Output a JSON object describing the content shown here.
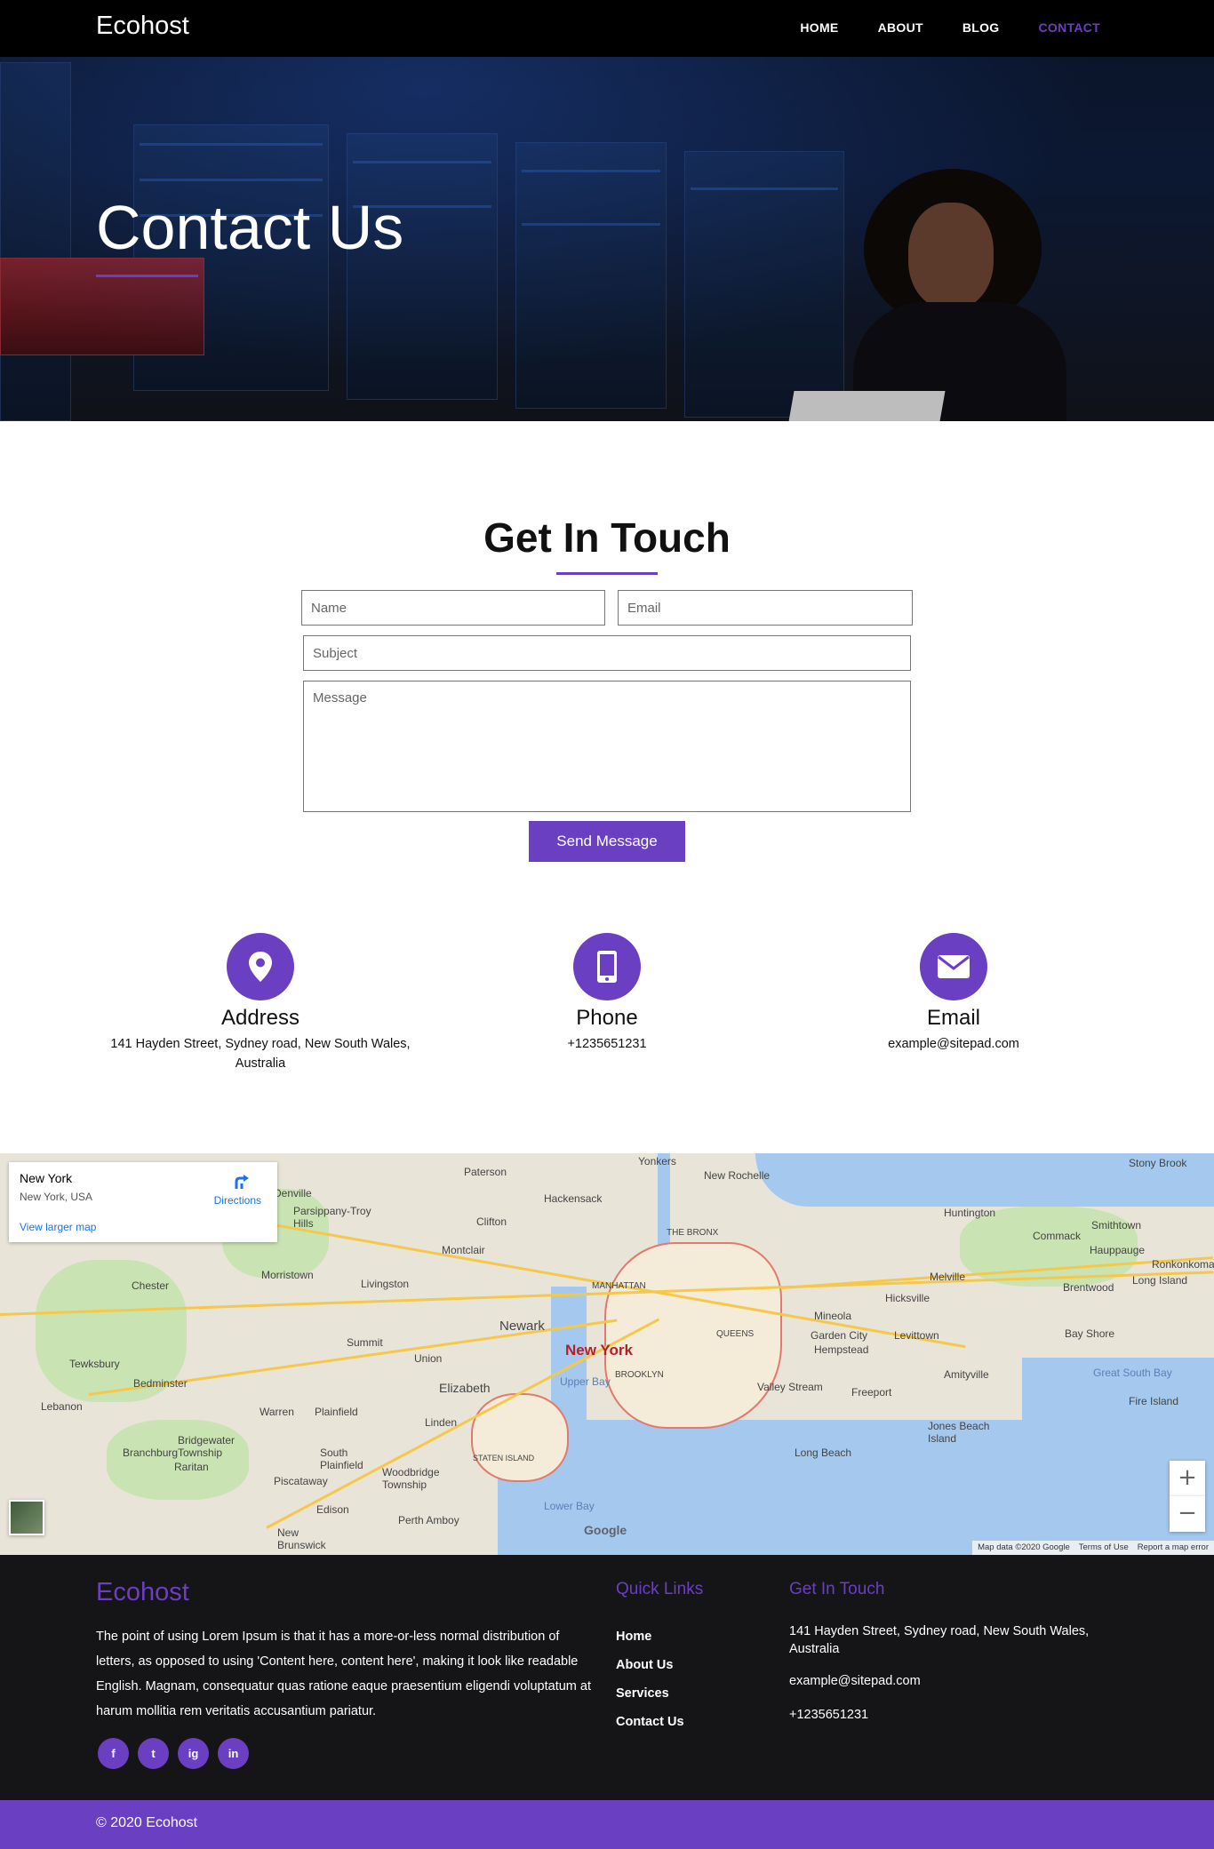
{
  "nav": {
    "brand": "Ecohost",
    "links": [
      "HOME",
      "ABOUT",
      "BLOG",
      "CONTACT"
    ]
  },
  "hero": {
    "title": "Contact Us"
  },
  "contact": {
    "title": "Get In Touch",
    "form": {
      "name_placeholder": "Name",
      "email_placeholder": "Email",
      "subject_placeholder": "Subject",
      "message_placeholder": "Message",
      "submit_label": "Send Message"
    },
    "info": [
      {
        "icon": "map-pin-icon",
        "title": "Address",
        "text": "141 Hayden Street, Sydney road, New South Wales, Australia"
      },
      {
        "icon": "phone-icon",
        "title": "Phone",
        "text": "+1235651231"
      },
      {
        "icon": "envelope-icon",
        "title": "Email",
        "text": "example@sitepad.com"
      }
    ]
  },
  "map": {
    "place_title": "New York",
    "place_subtitle": "New York, USA",
    "directions_label": "Directions",
    "larger_map_label": "View larger map",
    "labels": [
      "Yonkers",
      "New Rochelle",
      "Paterson",
      "Hackensack",
      "Clifton",
      "Montclair",
      "Huntington",
      "Stony Brook",
      "Smithtown",
      "Commack",
      "Hauppauge",
      "Ronkonkoma",
      "Long Island",
      "Melville",
      "Hicksville",
      "Mineola",
      "Garden City",
      "Hempstead",
      "Levittown",
      "Brentwood",
      "Bay Shore",
      "Amityville",
      "Great South Bay",
      "Fire Island",
      "Freeport",
      "Jones Beach Island",
      "Long Beach",
      "Valley Stream",
      "QUEENS",
      "BROOKLYN",
      "MANHATTAN",
      "THE BRONX",
      "New York",
      "Newark",
      "Elizabeth",
      "Union",
      "Summit",
      "Livingston",
      "Morristown",
      "Parsippany-Troy Hills",
      "Chester",
      "Tewksbury",
      "Bedminster",
      "Lebanon",
      "Warren",
      "Plainfield",
      "Bridgewater Township",
      "Branchburg",
      "Raritan",
      "South Plainfield",
      "Piscataway",
      "Woodbridge Township",
      "Linden",
      "STATEN ISLAND",
      "Edison",
      "New Brunswick",
      "Perth Amboy",
      "Lower Bay",
      "Upper Bay",
      "Denville"
    ],
    "google": "Google",
    "footer": [
      "Map data ©2020 Google",
      "Terms of Use",
      "Report a map error"
    ]
  },
  "footer": {
    "brand": "Ecohost",
    "about": "The point of using Lorem Ipsum is that it has a more-or-less normal distribution of letters, as opposed to using 'Content here, content here', making it look like readable English. Magnam, consequatur quas ratione eaque praesentium eligendi voluptatum at harum mollitia rem veritatis accusantium pariatur.",
    "socials": [
      "f",
      "t",
      "ig",
      "in"
    ],
    "quick_links_title": "Quick Links",
    "quick_links": [
      "Home",
      "About Us",
      "Services",
      "Contact Us"
    ],
    "contact_title": "Get In Touch",
    "address": "141 Hayden Street, Sydney road, New South Wales, Australia",
    "email": "example@sitepad.com",
    "phone": "+1235651231",
    "copyright": "© 2020 Ecohost"
  },
  "colors": {
    "accent": "#6a3fc2",
    "footer_bg": "#151417",
    "nav_bg": "#000000"
  }
}
